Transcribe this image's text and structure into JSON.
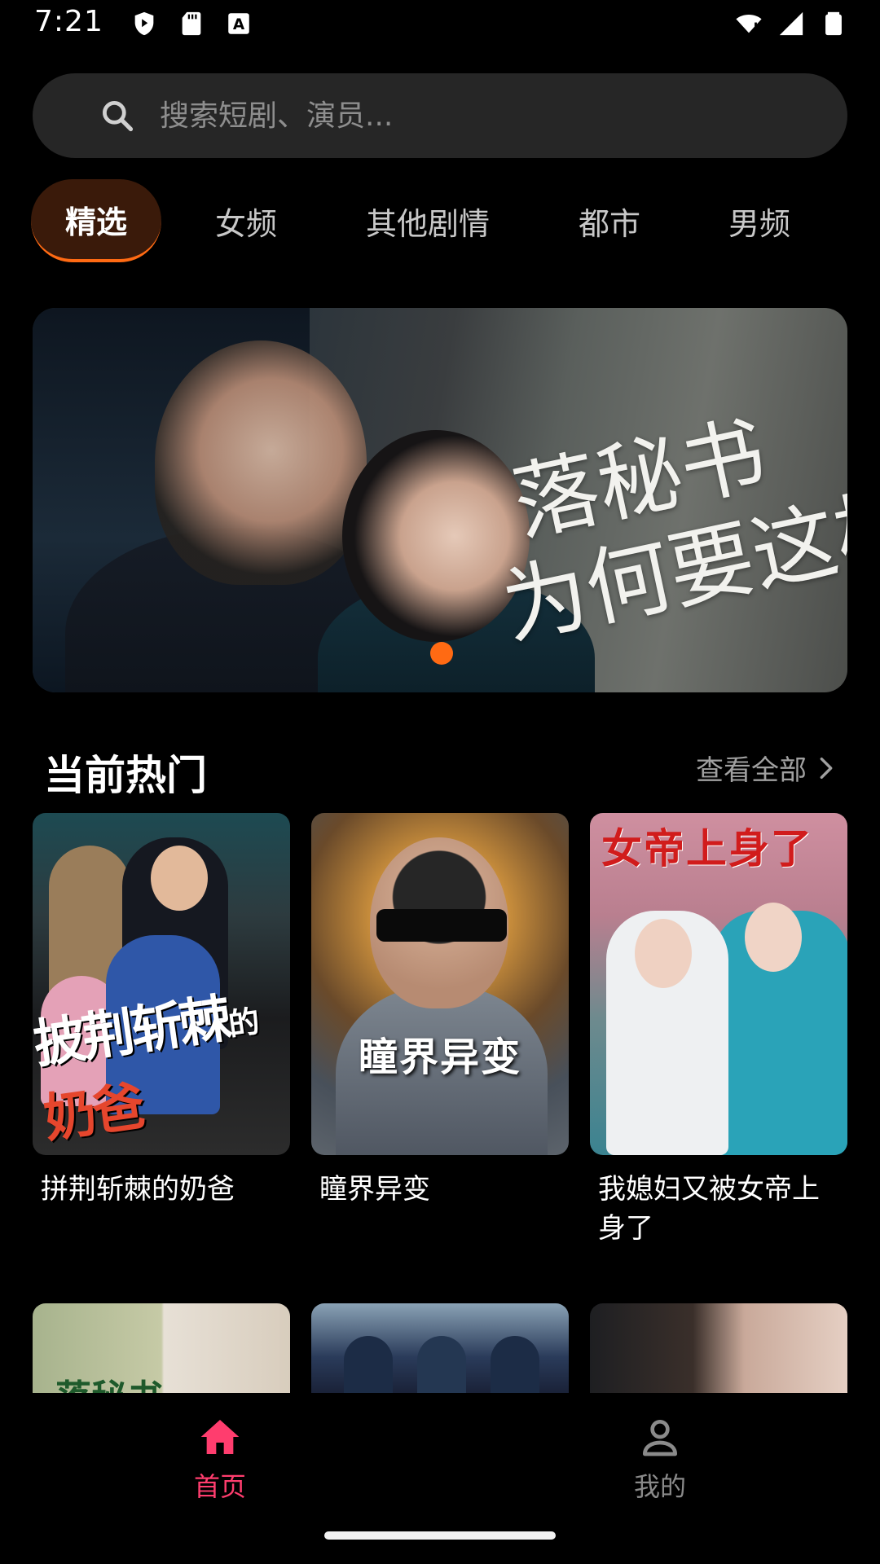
{
  "status_bar": {
    "time": "7:21",
    "left_icons": [
      "play-protect-icon",
      "sd-card-icon",
      "accessibility-icon"
    ],
    "right_icons": [
      "wifi-icon",
      "signal-icon",
      "battery-icon"
    ]
  },
  "search": {
    "placeholder": "搜索短剧、演员..."
  },
  "tabs": [
    {
      "label": "精选",
      "active": true
    },
    {
      "label": "女频",
      "active": false
    },
    {
      "label": "其他剧情",
      "active": false
    },
    {
      "label": "都市",
      "active": false
    },
    {
      "label": "男频",
      "active": false
    }
  ],
  "banner": {
    "title_line1": "落秘书",
    "title_line2": "为何要这样",
    "active_slide": 1
  },
  "section": {
    "title": "当前热门",
    "see_all": "查看全部"
  },
  "cards": [
    {
      "title": "拼荆斩棘的奶爸",
      "poster_text_1": "披荆斩棘",
      "poster_text_2": "的",
      "poster_text_3": "奶爸"
    },
    {
      "title": "瞳界异变",
      "poster_text": "瞳界异变"
    },
    {
      "title": "我媳妇又被女帝上身了",
      "poster_text": "女帝上身了"
    }
  ],
  "row2_cards": [
    {
      "poster_text": "落秘书"
    },
    {
      "poster_text": ""
    },
    {
      "poster_text": ""
    }
  ],
  "bottom_nav": [
    {
      "label": "首页",
      "icon": "home-icon",
      "active": true
    },
    {
      "label": "我的",
      "icon": "person-icon",
      "active": false
    }
  ],
  "colors": {
    "accent": "#ff6a13",
    "nav_active": "#ff3d6e",
    "nav_inactive": "#8a8a8a",
    "background": "#000000"
  }
}
